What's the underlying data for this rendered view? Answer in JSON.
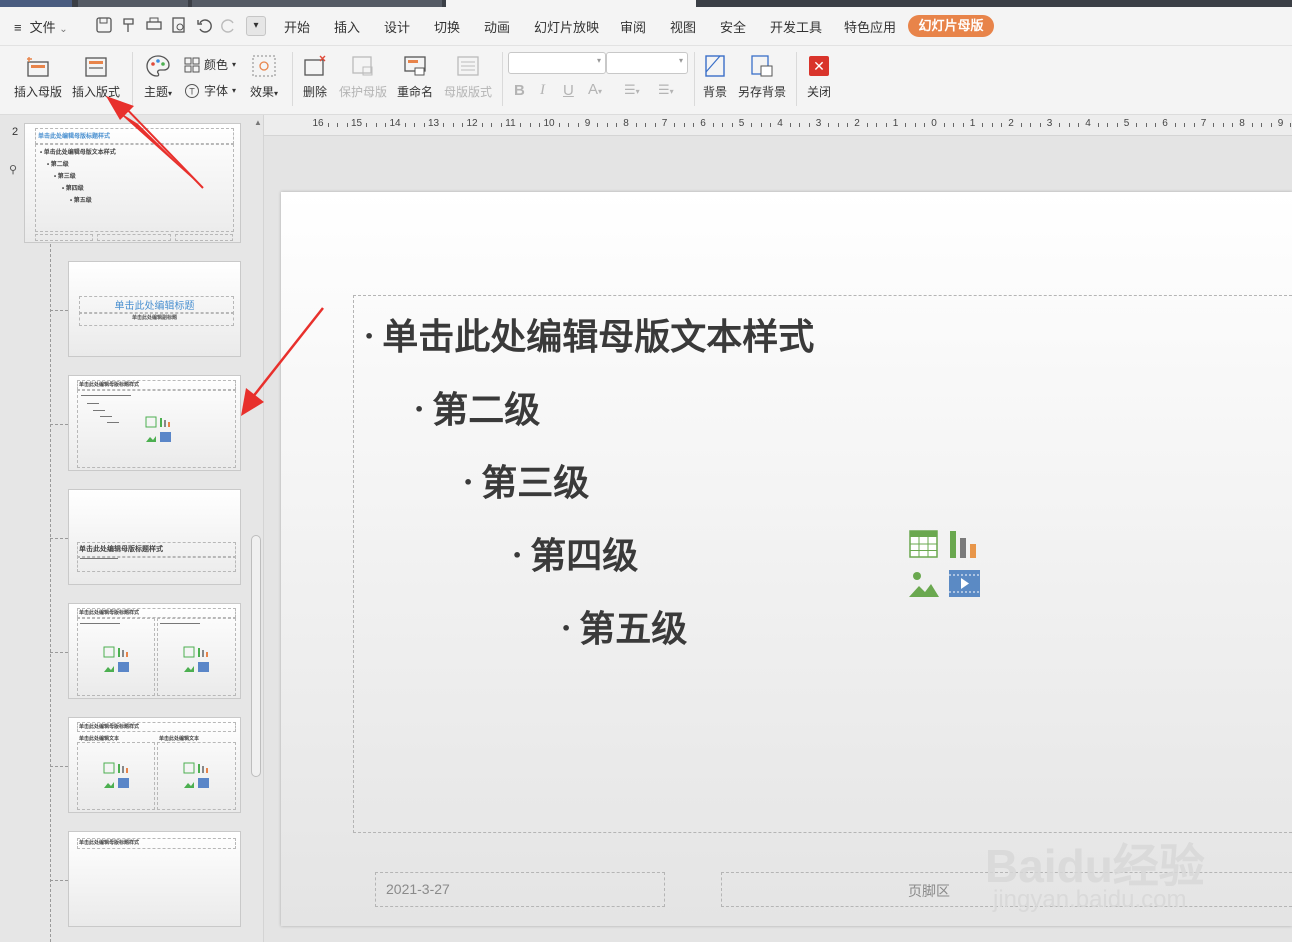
{
  "menubar": {
    "file_label": "文件",
    "tabs": [
      "开始",
      "插入",
      "设计",
      "切换",
      "动画",
      "幻灯片放映",
      "审阅",
      "视图",
      "安全",
      "开发工具",
      "特色应用"
    ],
    "active_tab": "幻灯片母版"
  },
  "ribbon": {
    "insert_master": "插入母版",
    "insert_layout": "插入版式",
    "theme": "主题",
    "color": "颜色",
    "font": "字体",
    "effect": "效果",
    "delete": "删除",
    "protect_master": "保护母版",
    "rename": "重命名",
    "master_layout": "母版版式",
    "background": "背景",
    "save_background": "另存背景",
    "close": "关闭"
  },
  "slides_panel": {
    "slide_number": "2",
    "master_title": "单击此处编辑母版标题样式",
    "master_body": [
      "单击此处编辑母版文本样式",
      "第二级",
      "第三级",
      "第四级",
      "第五级"
    ],
    "layout1_title": "单击此处编辑标题",
    "layout1_subtitle": "单击此处编辑副标题",
    "layout2_title": "单击此处编辑母版标题样式",
    "layout3_title": "单击此处编辑母版标题样式",
    "layout4_title": "单击此处编辑母版标题样式",
    "layout5_title": "单击此处编辑母版标题样式",
    "layout5_sub": "单击此处编辑文本",
    "layout6_title": "单击此处编辑母版标题样式"
  },
  "ruler": {
    "labels": [
      "16",
      "15",
      "14",
      "13",
      "12",
      "11",
      "10",
      "9",
      "8",
      "7",
      "6",
      "5",
      "4",
      "3",
      "2",
      "1",
      "0",
      "1",
      "2",
      "3",
      "4",
      "5",
      "6",
      "7",
      "8",
      "9"
    ]
  },
  "slide": {
    "levels": [
      "单击此处编辑母版文本样式",
      "第二级",
      "第三级",
      "第四级",
      "第五级"
    ],
    "date": "2021-3-27",
    "footer": "页脚区"
  },
  "watermark": {
    "brand": "Baidu经验",
    "url": "jingyan.baidu.com"
  },
  "colors": {
    "accent": "#e8844a",
    "arrow": "#e8302c",
    "close": "#d9342b"
  }
}
